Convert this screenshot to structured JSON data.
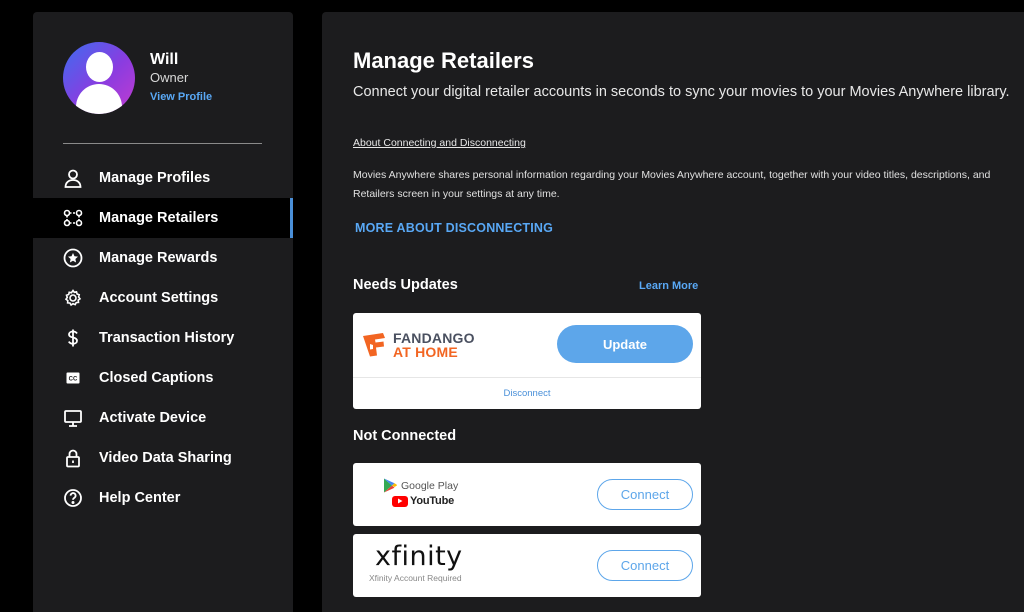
{
  "profile": {
    "name": "Will",
    "role": "Owner",
    "view_profile": "View Profile"
  },
  "nav": [
    {
      "label": "Manage Profiles",
      "icon": "person-icon",
      "active": false
    },
    {
      "label": "Manage Retailers",
      "icon": "retailers-icon",
      "active": true
    },
    {
      "label": "Manage Rewards",
      "icon": "star-icon",
      "active": false
    },
    {
      "label": "Account Settings",
      "icon": "gear-icon",
      "active": false
    },
    {
      "label": "Transaction History",
      "icon": "dollar-icon",
      "active": false
    },
    {
      "label": "Closed Captions",
      "icon": "cc-icon",
      "active": false
    },
    {
      "label": "Activate Device",
      "icon": "monitor-icon",
      "active": false
    },
    {
      "label": "Video Data Sharing",
      "icon": "lock-icon",
      "active": false
    },
    {
      "label": "Help Center",
      "icon": "help-icon",
      "active": false
    }
  ],
  "main": {
    "title": "Manage Retailers",
    "subtitle": "Connect your digital retailer accounts in seconds to sync your movies to your Movies Anywhere library.",
    "about_link": "About Connecting and Disconnecting",
    "paragraph_line1": "Movies Anywhere shares personal information regarding your Movies Anywhere account, together with your video titles, descriptions, and",
    "paragraph_line2": "Retailers screen in your settings at any time.",
    "more_link": "MORE ABOUT DISCONNECTING"
  },
  "needs_updates": {
    "heading": "Needs Updates",
    "learn_more": "Learn More",
    "retailer": {
      "logo_line1": "FANDANGO",
      "logo_line2": "AT HOME",
      "update_label": "Update",
      "disconnect_label": "Disconnect"
    }
  },
  "not_connected": {
    "heading": "Not Connected",
    "retailers": [
      {
        "logo_line1": "Google Play",
        "logo_line2": "YouTube",
        "connect_label": "Connect"
      },
      {
        "logo_line1": "xfinity",
        "logo_line2": "Xfinity Account Required",
        "connect_label": "Connect"
      }
    ]
  },
  "colors": {
    "accent": "#5da6ea",
    "link": "#59a8f5",
    "panel": "#1c1c1e",
    "fandango_orange": "#f26522"
  }
}
